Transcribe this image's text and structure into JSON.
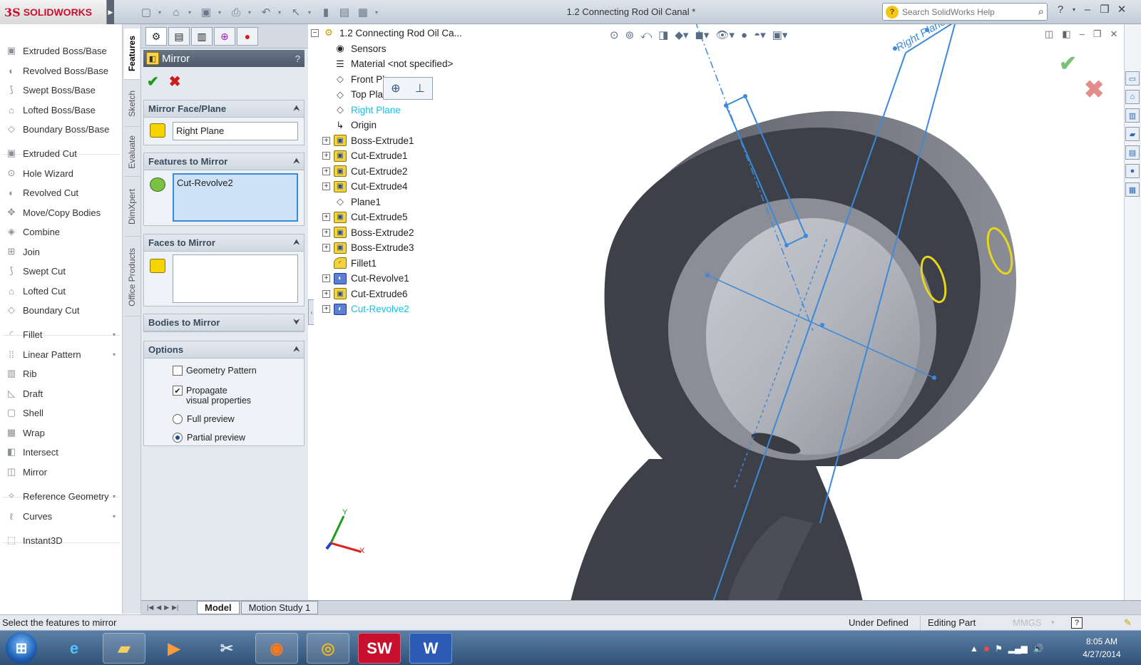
{
  "titlebar": {
    "logo_text": "SOLIDWORKS",
    "logo_mark": "3S",
    "doc_title": "1.2 Connecting Rod Oil Canal *",
    "search_placeholder": "Search SolidWorks Help",
    "help_icon": "?"
  },
  "command_manager": {
    "items": [
      {
        "label": "Extruded Boss/Base",
        "icon": "extruded-boss-icon"
      },
      {
        "label": "Revolved Boss/Base",
        "icon": "revolved-boss-icon"
      },
      {
        "label": "Swept Boss/Base",
        "icon": "swept-boss-icon"
      },
      {
        "label": "Lofted Boss/Base",
        "icon": "lofted-boss-icon"
      },
      {
        "label": "Boundary Boss/Base",
        "icon": "boundary-boss-icon"
      },
      {
        "label": "Extruded Cut",
        "icon": "extruded-cut-icon"
      },
      {
        "label": "Hole Wizard",
        "icon": "hole-wizard-icon"
      },
      {
        "label": "Revolved Cut",
        "icon": "revolved-cut-icon"
      },
      {
        "label": "Move/Copy Bodies",
        "icon": "move-copy-icon"
      },
      {
        "label": "Combine",
        "icon": "combine-icon"
      },
      {
        "label": "Join",
        "icon": "join-icon"
      },
      {
        "label": "Swept Cut",
        "icon": "swept-cut-icon"
      },
      {
        "label": "Lofted Cut",
        "icon": "lofted-cut-icon"
      },
      {
        "label": "Boundary Cut",
        "icon": "boundary-cut-icon"
      },
      {
        "label": "Fillet",
        "icon": "fillet-icon"
      },
      {
        "label": "Linear Pattern",
        "icon": "linear-pattern-icon"
      },
      {
        "label": "Rib",
        "icon": "rib-icon"
      },
      {
        "label": "Draft",
        "icon": "draft-icon"
      },
      {
        "label": "Shell",
        "icon": "shell-icon"
      },
      {
        "label": "Wrap",
        "icon": "wrap-icon"
      },
      {
        "label": "Intersect",
        "icon": "intersect-icon"
      },
      {
        "label": "Mirror",
        "icon": "mirror-icon"
      },
      {
        "label": "Reference Geometry",
        "icon": "reference-geometry-icon"
      },
      {
        "label": "Curves",
        "icon": "curves-icon"
      },
      {
        "label": "Instant3D",
        "icon": "instant3d-icon"
      }
    ],
    "vertical_tabs": [
      "Features",
      "Sketch",
      "Evaluate",
      "DimXpert",
      "Office Products"
    ]
  },
  "property_manager": {
    "title": "Mirror",
    "help": "?",
    "groups": {
      "mirror_face": {
        "title": "Mirror Face/Plane",
        "value": "Right Plane"
      },
      "features": {
        "title": "Features to Mirror",
        "value": "Cut-Revolve2"
      },
      "faces": {
        "title": "Faces to Mirror",
        "value": ""
      },
      "bodies": {
        "title": "Bodies to Mirror"
      },
      "options": {
        "title": "Options",
        "geometry_pattern": "Geometry Pattern",
        "propagate": "Propagate visual properties",
        "full_preview": "Full preview",
        "partial_preview": "Partial preview"
      }
    }
  },
  "feature_tree": {
    "root": "1.2 Connecting Rod Oil Ca...",
    "items": [
      {
        "label": "Sensors",
        "icon": "sensors-icon",
        "expandable": false
      },
      {
        "label": "Material <not specified>",
        "icon": "material-icon",
        "expandable": false
      },
      {
        "label": "Front Plane",
        "icon": "plane-icon",
        "expandable": false
      },
      {
        "label": "Top Plane",
        "icon": "plane-icon",
        "expandable": false
      },
      {
        "label": "Right Plane",
        "icon": "plane-icon",
        "expandable": false,
        "highlight": true
      },
      {
        "label": "Origin",
        "icon": "origin-icon",
        "expandable": false
      },
      {
        "label": "Boss-Extrude1",
        "icon": "extrude-icon",
        "expandable": true
      },
      {
        "label": "Cut-Extrude1",
        "icon": "extrude-icon",
        "expandable": true
      },
      {
        "label": "Cut-Extrude2",
        "icon": "extrude-icon",
        "expandable": true
      },
      {
        "label": "Cut-Extrude4",
        "icon": "extrude-icon",
        "expandable": true
      },
      {
        "label": "Plane1",
        "icon": "plane-icon",
        "expandable": false
      },
      {
        "label": "Cut-Extrude5",
        "icon": "extrude-icon",
        "expandable": true
      },
      {
        "label": "Boss-Extrude2",
        "icon": "extrude-icon",
        "expandable": true
      },
      {
        "label": "Boss-Extrude3",
        "icon": "extrude-icon",
        "expandable": true
      },
      {
        "label": "Fillet1",
        "icon": "fillet-icon",
        "expandable": false
      },
      {
        "label": "Cut-Revolve1",
        "icon": "revolve-icon",
        "expandable": true
      },
      {
        "label": "Cut-Extrude6",
        "icon": "extrude-icon",
        "expandable": true
      },
      {
        "label": "Cut-Revolve2",
        "icon": "revolve-icon",
        "expandable": true,
        "highlight": true
      }
    ]
  },
  "viewport": {
    "plane_label": "Right Plane",
    "axis_x": "X",
    "axis_y": "Y"
  },
  "bottom_tabs": [
    "Model",
    "Motion Study 1"
  ],
  "status": {
    "message": "Select the features to mirror",
    "state": "Under Defined",
    "mode": "Editing Part",
    "units": "MMGS"
  },
  "taskbar": {
    "time": "8:05 AM",
    "date": "4/27/2014",
    "apps": [
      "internet-explorer-icon",
      "file-explorer-icon",
      "media-player-icon",
      "tools-icon",
      "firefox-icon",
      "chrome-icon",
      "solidworks-icon",
      "word-icon"
    ]
  },
  "colors": {
    "highlight": "#12c2e9",
    "model_dark": "#3d4048",
    "sketch_blue": "#3b8ad9",
    "oil_hole": "#e7d61a"
  }
}
